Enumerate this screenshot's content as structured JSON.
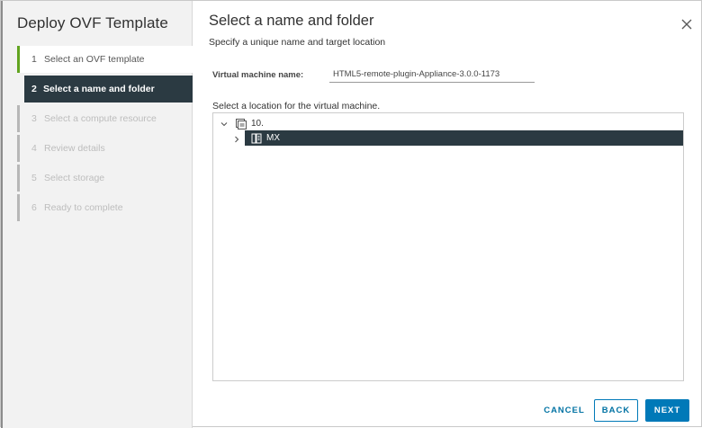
{
  "wizard": {
    "title": "Deploy OVF Template",
    "steps": [
      {
        "num": "1",
        "label": "Select an OVF template",
        "state": "done"
      },
      {
        "num": "2",
        "label": "Select a name and folder",
        "state": "active"
      },
      {
        "num": "3",
        "label": "Select a compute resource",
        "state": "pending"
      },
      {
        "num": "4",
        "label": "Review details",
        "state": "pending"
      },
      {
        "num": "5",
        "label": "Select storage",
        "state": "pending"
      },
      {
        "num": "6",
        "label": "Ready to complete",
        "state": "pending"
      }
    ]
  },
  "main": {
    "title": "Select a name and folder",
    "subtitle": "Specify a unique name and target location",
    "vm_name_label": "Virtual machine name:",
    "vm_name_value": "HTML5-remote-plugin-Appliance-3.0.0-1173",
    "location_label": "Select a location for the virtual machine.",
    "tree": {
      "root": {
        "label": "10.",
        "icon": "vcenter-icon",
        "expanded": true
      },
      "child": {
        "label": "MX",
        "icon": "datacenter-icon",
        "selected": true,
        "expanded": false
      }
    }
  },
  "footer": {
    "cancel_label": "CANCEL",
    "back_label": "BACK",
    "next_label": "NEXT"
  },
  "colors": {
    "accent": "#0079b8",
    "selected_bg": "#2b3a42",
    "done_bar": "#62a420",
    "sidebar_bg": "#f2f2f2"
  }
}
